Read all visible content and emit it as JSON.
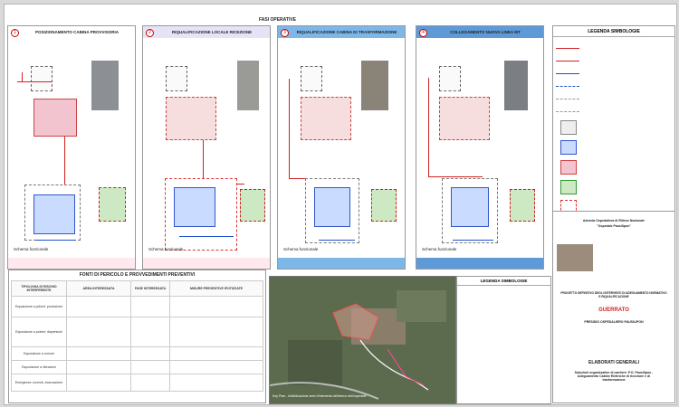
{
  "header": {
    "phases_title": "FASI OPERATIVE"
  },
  "panels": [
    {
      "num": "1",
      "title": "POSIZIONAMENTO CABINA PROVVISORIA",
      "schema": "Schema funzionale",
      "top_color": "#ffffff"
    },
    {
      "num": "2",
      "title": "RIQUALIFICAZIONE LOCALE RICEZIONE",
      "schema": "Schema funzionale",
      "top_color": "#e5e3f5"
    },
    {
      "num": "3",
      "title": "RIQUALIFICAZIONE CABINA DI TRASFORMAZIONE",
      "schema": "Schema funzionale",
      "top_color": "#7db7e8"
    },
    {
      "num": "4",
      "title": "COLLEGAMENTO NUOVA LINEA MT",
      "schema": "Schema funzionale",
      "top_color": "#5e9ad7"
    }
  ],
  "legend_top": {
    "title": "LEGENDA SIMBOLOGIE"
  },
  "risk_section": {
    "title": "FONTI DI PERICOLO E PROVVEDIMENTI PREVENTIVI",
    "headers": {
      "col1": "TIPOLOGIA DI RISCHIO INTERFERENTE",
      "col2": "AREA INTERESSATA",
      "col3": "FASE INTERESSATA",
      "col4": "MISURE PREVENTIVE IPOTIZZATE"
    },
    "rows": [
      "Esposizione a polveri: produzione",
      "Esposizione a polveri: dispersioni",
      "Esposizione a rumore",
      "Esposizione a vibrazioni",
      "Emergenze, incendi, evacuazione"
    ]
  },
  "map": {
    "caption": "Key Plan - Individuazione area d'intervento all'interno dell'ospedale",
    "legend_title": "LEGENDA SIMBOLOGIE"
  },
  "titleblock": {
    "authority": "Azienda Ospedaliera di Rilievo Nazionale",
    "authority_name": "\"Ospedale Pausilipon\"",
    "project_title": "PROGETTO DEFINITIVO DEGLI INTERVENTI DI ADEGUAMENTO NORMATIVO E RIQUALIFICAZIONE",
    "hospital": "PRESIDIO OSPEDALIERO PAUSILIPON",
    "logo": "GUERRATO",
    "section": "ELABORATI GENERALI",
    "doc_title": "Soluzioni organizzative di cantiere: P.O. Pausilipon - Adeguamento Cabine Elettriche di ricezione e di trasformazione"
  }
}
